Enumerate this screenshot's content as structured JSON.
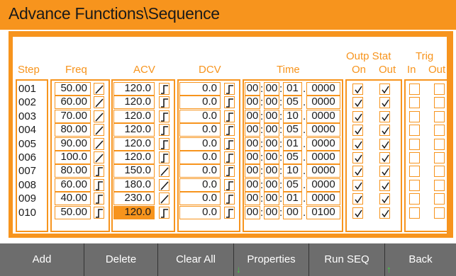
{
  "title": "Advance Functions\\Sequence",
  "headers": {
    "step": "Step",
    "freq": "Freq",
    "acv": "ACV",
    "dcv": "DCV",
    "time": "Time",
    "outp_stat": "Outp Stat",
    "on": "On",
    "out": "Out",
    "trig": "Trig",
    "trig_in": "In",
    "trig_out": "Out"
  },
  "rows": [
    {
      "step": "001",
      "freq": "50.00",
      "freq_mode": "ramp",
      "acv": "120.0",
      "acv_mode": "step",
      "dcv": "0.0",
      "dcv_mode": "step",
      "hh": "00",
      "mm": "00",
      "ss": "01",
      "frac": "0000",
      "on": true,
      "out": true,
      "trig_in": false,
      "trig_out": false
    },
    {
      "step": "002",
      "freq": "60.00",
      "freq_mode": "ramp",
      "acv": "120.0",
      "acv_mode": "step",
      "dcv": "0.0",
      "dcv_mode": "step",
      "hh": "00",
      "mm": "00",
      "ss": "05",
      "frac": "0000",
      "on": true,
      "out": true,
      "trig_in": false,
      "trig_out": false
    },
    {
      "step": "003",
      "freq": "70.00",
      "freq_mode": "ramp",
      "acv": "120.0",
      "acv_mode": "step",
      "dcv": "0.0",
      "dcv_mode": "step",
      "hh": "00",
      "mm": "00",
      "ss": "10",
      "frac": "0000",
      "on": true,
      "out": true,
      "trig_in": false,
      "trig_out": false
    },
    {
      "step": "004",
      "freq": "80.00",
      "freq_mode": "ramp",
      "acv": "120.0",
      "acv_mode": "step",
      "dcv": "0.0",
      "dcv_mode": "step",
      "hh": "00",
      "mm": "00",
      "ss": "05",
      "frac": "0000",
      "on": true,
      "out": true,
      "trig_in": false,
      "trig_out": false
    },
    {
      "step": "005",
      "freq": "90.00",
      "freq_mode": "ramp",
      "acv": "120.0",
      "acv_mode": "step",
      "dcv": "0.0",
      "dcv_mode": "step",
      "hh": "00",
      "mm": "00",
      "ss": "01",
      "frac": "0000",
      "on": true,
      "out": true,
      "trig_in": false,
      "trig_out": false
    },
    {
      "step": "006",
      "freq": "100.0",
      "freq_mode": "ramp",
      "acv": "120.0",
      "acv_mode": "step",
      "dcv": "0.0",
      "dcv_mode": "step",
      "hh": "00",
      "mm": "00",
      "ss": "05",
      "frac": "0000",
      "on": true,
      "out": true,
      "trig_in": false,
      "trig_out": false
    },
    {
      "step": "007",
      "freq": "80.00",
      "freq_mode": "step",
      "acv": "150.0",
      "acv_mode": "ramp",
      "dcv": "0.0",
      "dcv_mode": "step",
      "hh": "00",
      "mm": "00",
      "ss": "10",
      "frac": "0000",
      "on": true,
      "out": true,
      "trig_in": false,
      "trig_out": false
    },
    {
      "step": "008",
      "freq": "60.00",
      "freq_mode": "step",
      "acv": "180.0",
      "acv_mode": "ramp",
      "dcv": "0.0",
      "dcv_mode": "step",
      "hh": "00",
      "mm": "00",
      "ss": "05",
      "frac": "0000",
      "on": true,
      "out": true,
      "trig_in": false,
      "trig_out": false
    },
    {
      "step": "009",
      "freq": "40.00",
      "freq_mode": "step",
      "acv": "230.0",
      "acv_mode": "ramp",
      "dcv": "0.0",
      "dcv_mode": "step",
      "hh": "00",
      "mm": "00",
      "ss": "01",
      "frac": "0000",
      "on": true,
      "out": true,
      "trig_in": false,
      "trig_out": false
    },
    {
      "step": "010",
      "freq": "50.00",
      "freq_mode": "step",
      "acv": "120.0",
      "acv_mode": "step",
      "dcv": "0.0",
      "dcv_mode": "step",
      "hh": "00",
      "mm": "00",
      "ss": "00",
      "frac": "0100",
      "on": true,
      "out": true,
      "trig_in": false,
      "trig_out": false
    }
  ],
  "selected_cell": "acv",
  "selected_row": 9,
  "buttons": [
    "Add",
    "Delete",
    "Clear All",
    "Properties",
    "Run SEQ",
    "Back"
  ],
  "colors": {
    "accent": "#f7941d",
    "bar": "#6d6d6d",
    "arrow": "#3fd43f"
  }
}
